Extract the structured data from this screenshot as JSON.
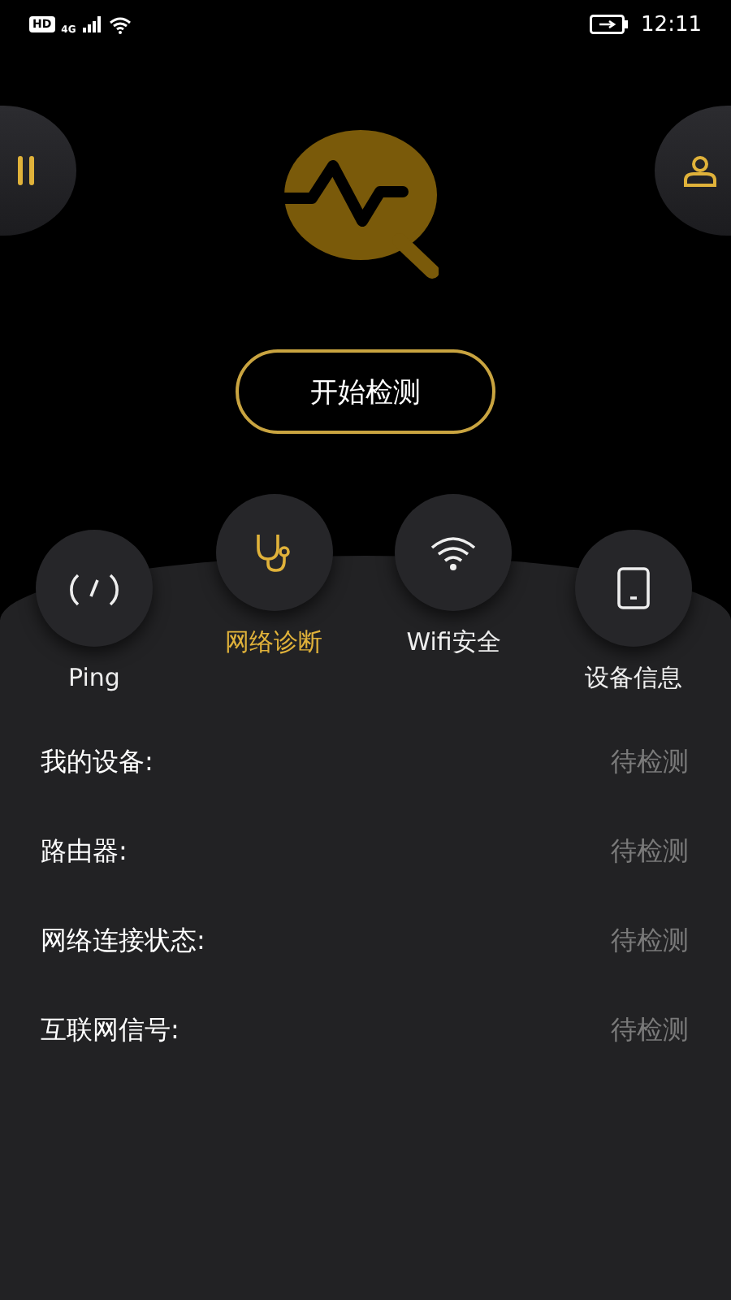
{
  "status_bar": {
    "hd": "HD",
    "network": "4G",
    "time": "12:11"
  },
  "start_button": "开始检测",
  "tools": [
    {
      "label": "Ping",
      "kind": "gauge",
      "selected": false
    },
    {
      "label": "网络诊断",
      "kind": "stethoscope",
      "selected": true
    },
    {
      "label": "Wifi安全",
      "kind": "wifi",
      "selected": false
    },
    {
      "label": "设备信息",
      "kind": "device",
      "selected": false
    }
  ],
  "rows": [
    {
      "label": "我的设备:",
      "status": "待检测"
    },
    {
      "label": "路由器:",
      "status": "待检测"
    },
    {
      "label": "网络连接状态:",
      "status": "待检测"
    },
    {
      "label": "互联网信号:",
      "status": "待检测"
    }
  ]
}
